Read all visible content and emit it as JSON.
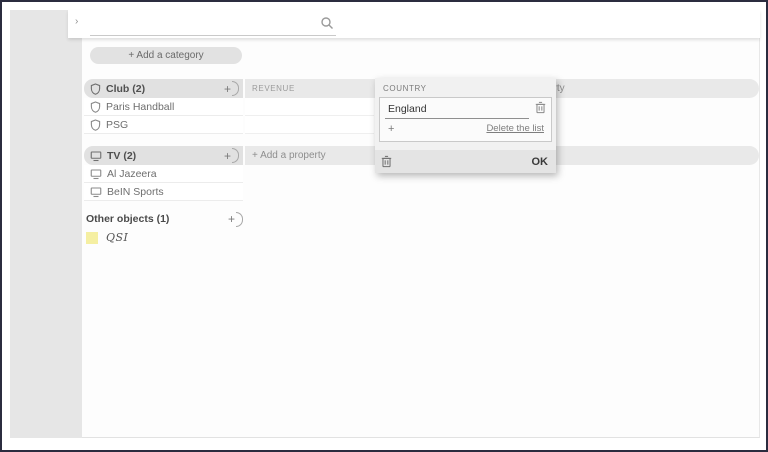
{
  "topbar": {
    "collapse_chevron": "›",
    "search_value": ""
  },
  "actions": {
    "add_category": "+ Add a category",
    "add_property": "+ Add a property",
    "add_item": "+"
  },
  "categories": [
    {
      "label": "Club (2)",
      "icon": "shield-icon",
      "property_headers": [
        "REVENUE"
      ],
      "items": [
        "Paris Handball",
        "PSG"
      ]
    },
    {
      "label": "TV (2)",
      "icon": "tv-icon",
      "property_headers": [],
      "items": [
        "Al Jazeera",
        "BeIN Sports"
      ]
    }
  ],
  "other_objects": {
    "label": "Other objects (1)",
    "item": "QSI",
    "item_color": "#f5efa2"
  },
  "popup": {
    "title": "COUNTRY",
    "field_value": "England",
    "add_value_label": "+",
    "delete_list_label": "Delete the list",
    "ok_label": "OK"
  },
  "colors": {
    "frame_border": "#2b2c3f",
    "pill_gray": "#e2e2e2",
    "item_yellow": "#f5efa2"
  }
}
